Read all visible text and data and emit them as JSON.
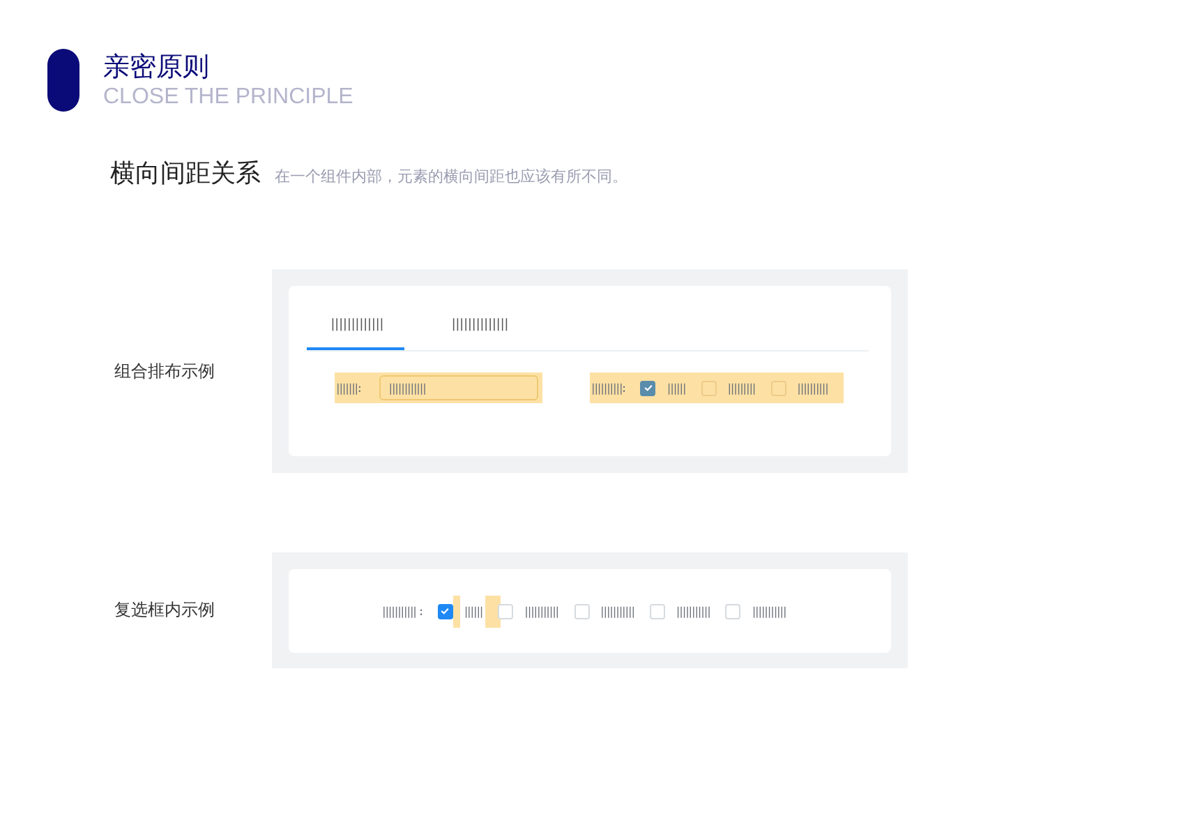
{
  "header": {
    "title": "亲密原则",
    "subtitle": "CLOSE THE PRINCIPLE"
  },
  "section": {
    "title": "横向间距关系",
    "note": "在一个组件内部，元素的横向间距也应该有所不同。"
  },
  "combo_example": {
    "label": "组合排布示例",
    "tabs": [
      {
        "label": "|||||||||||||",
        "selected": true
      },
      {
        "label": "||||||||||||||",
        "selected": false
      }
    ],
    "field": {
      "label": "|||||||:",
      "value": "||||||||||||"
    },
    "checkbox_group": {
      "label": "||||||||||:",
      "options": [
        {
          "label": "||||||",
          "checked": true
        },
        {
          "label": "|||||||||",
          "checked": false
        },
        {
          "label": "||||||||||",
          "checked": false
        }
      ]
    }
  },
  "checkbox_example": {
    "label": "复选框内示例",
    "checkbox_group": {
      "label": "||||||||||| :",
      "options": [
        {
          "label": "||||||",
          "checked": true
        },
        {
          "label": "|||||||||||",
          "checked": false
        },
        {
          "label": "|||||||||||",
          "checked": false
        },
        {
          "label": "|||||||||||",
          "checked": false
        },
        {
          "label": "|||||||||||",
          "checked": false
        }
      ]
    }
  }
}
